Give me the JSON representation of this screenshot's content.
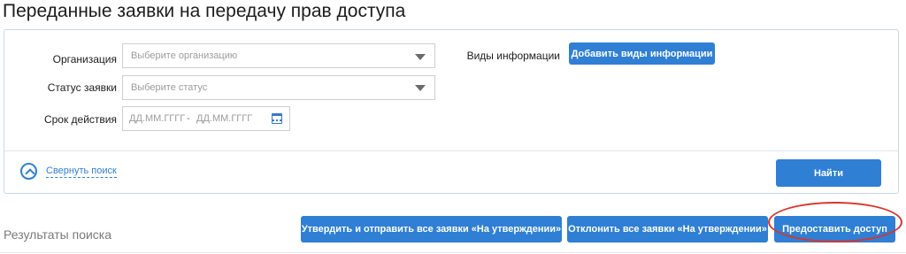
{
  "page": {
    "title": "Переданные заявки на передачу прав доступа"
  },
  "filters": {
    "organization": {
      "label": "Организация",
      "placeholder": "Выберите организацию"
    },
    "status": {
      "label": "Статус заявки",
      "placeholder": "Выберите статус"
    },
    "validity": {
      "label": "Срок действия",
      "from_placeholder": "ДД.ММ.ГГГГ",
      "separator": "-",
      "to_placeholder": "ДД.ММ.ГГГГ"
    },
    "info_types": {
      "label": "Виды информации",
      "add_button": "Добавить виды информации"
    },
    "collapse_label": "Свернуть поиск",
    "search_button": "Найти"
  },
  "results": {
    "title": "Результаты поиска",
    "approve_all_button": "Утвердить и отправить все заявки «На утверждении»",
    "reject_all_button": "Отклонить все заявки «На утверждении»",
    "grant_access_button": "Предоставить доступ"
  },
  "colors": {
    "accent": "#2f7fd4",
    "highlight": "#d9352c",
    "panel_border": "#c9d7e8"
  },
  "icons": {
    "dropdown": "chevron-down-icon",
    "calendar": "calendar-icon",
    "collapse": "chevron-up-circle-icon"
  }
}
